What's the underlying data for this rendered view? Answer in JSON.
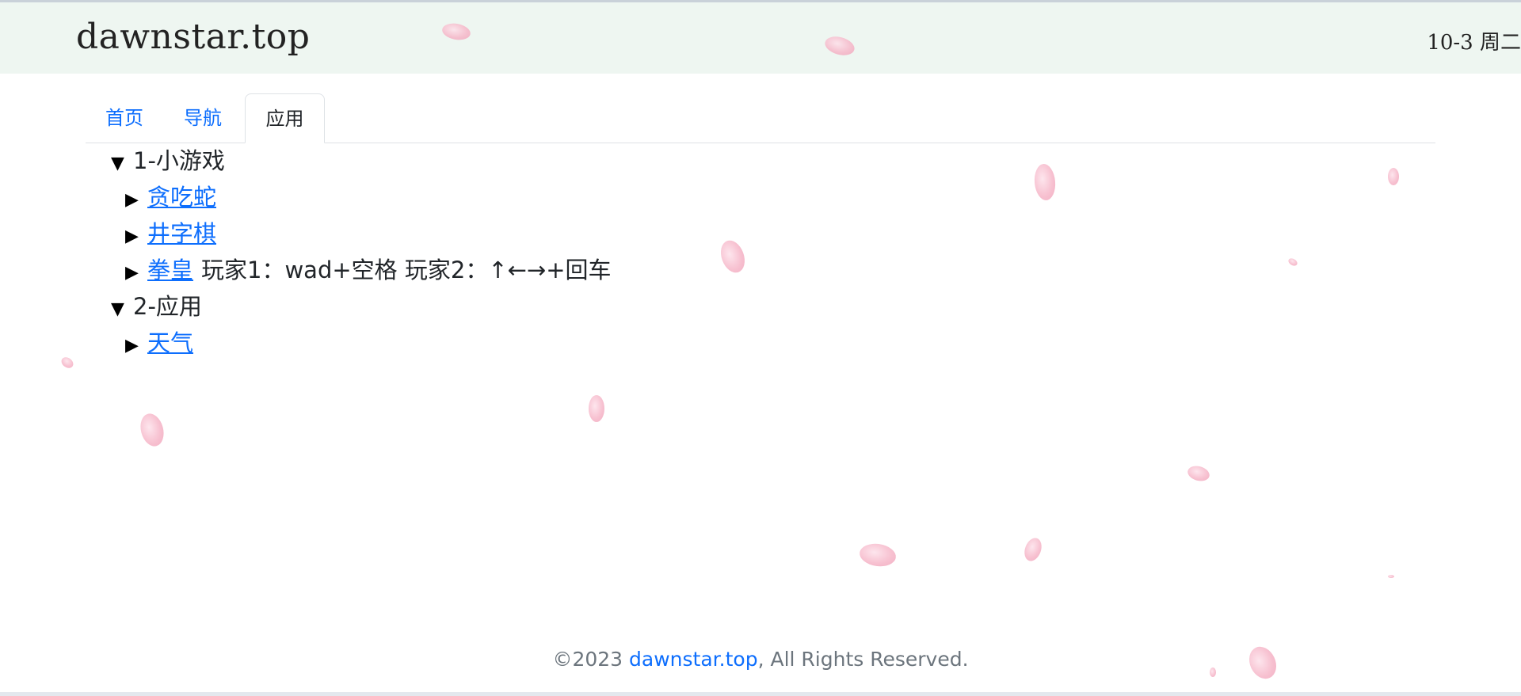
{
  "header": {
    "brand": "dawnstar.top",
    "datetime": "10-3 周二"
  },
  "tabs": [
    {
      "label": "首页",
      "active": false
    },
    {
      "label": "导航",
      "active": false
    },
    {
      "label": "应用",
      "active": true
    }
  ],
  "tree": {
    "groups": [
      {
        "label": "1-小游戏",
        "items": [
          {
            "label": "贪吃蛇",
            "note": ""
          },
          {
            "label": "井字棋",
            "note": ""
          },
          {
            "label": "拳皇",
            "note": "玩家1：wad+空格 玩家2：↑←→+回车"
          }
        ]
      },
      {
        "label": "2-应用",
        "items": [
          {
            "label": "天气",
            "note": ""
          }
        ]
      }
    ]
  },
  "footer": {
    "prefix": "©2023 ",
    "link": "dawnstar.top",
    "suffix": ", All Rights Reserved."
  },
  "colors": {
    "header_bg": "#eef6f1",
    "link": "#0d6efd",
    "petal": "#f6b7c9"
  },
  "icons": {
    "expanded": "triangle-down-icon",
    "collapsed": "triangle-right-icon",
    "decoration": "sakura-petal-icon"
  }
}
